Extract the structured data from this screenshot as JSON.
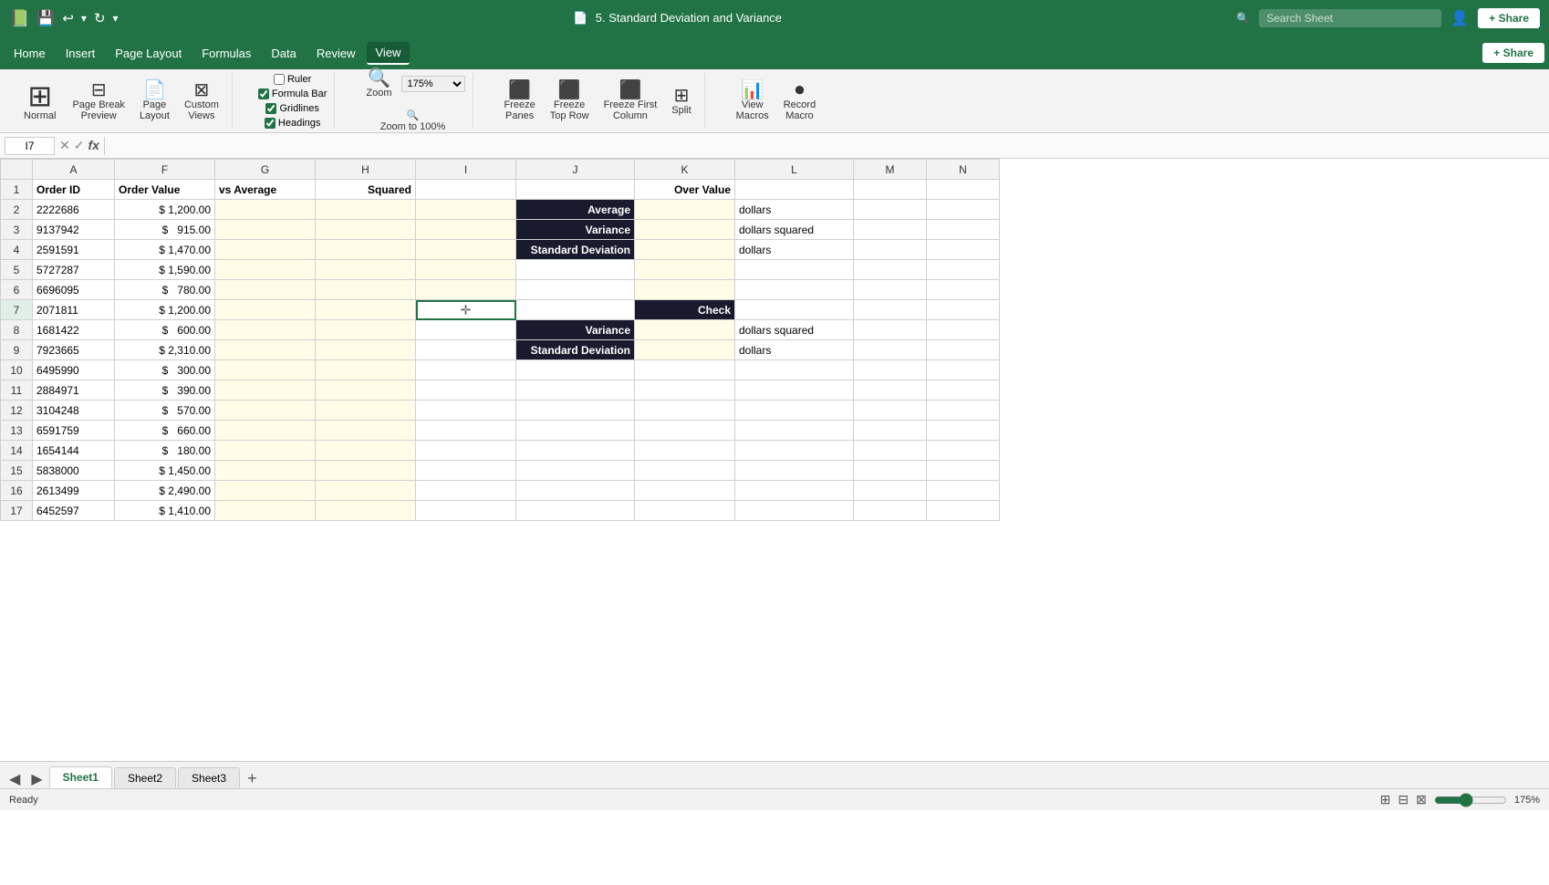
{
  "titleBar": {
    "fileIcon": "📄",
    "title": "5. Standard Deviation and Variance",
    "undoIcon": "↩",
    "redoIcon": "↻",
    "saveIcon": "💾",
    "moreIcon": "▾",
    "searchPlaceholder": "Search Sheet",
    "profileIcon": "👤",
    "shareLabel": "+ Share"
  },
  "menuBar": {
    "items": [
      "Home",
      "Insert",
      "Page Layout",
      "Formulas",
      "Data",
      "Review",
      "View"
    ]
  },
  "ribbon": {
    "view": {
      "normalLabel": "Normal",
      "pageBreakLabel": "Page Break\nPreview",
      "pageLayoutLabel": "Page\nLayout",
      "customViewsLabel": "Custom\nViews",
      "rulerLabel": "Ruler",
      "formulaBarLabel": "Formula Bar",
      "gridlinesLabel": "Gridlines",
      "headingsLabel": "Headings",
      "zoomLabel": "Zoom",
      "zoomValue": "175%",
      "zoom100Label": "Zoom to 100%",
      "freezePanesLabel": "Freeze\nPanes",
      "freezeTopRowLabel": "Freeze\nTop Row",
      "freezeFirstColLabel": "Freeze First\nColumn",
      "splitLabel": "Split",
      "viewMacrosLabel": "View\nMacros",
      "recordMacroLabel": "Record\nMacro"
    }
  },
  "formulaBar": {
    "cellRef": "I7",
    "cancelIcon": "✕",
    "confirmIcon": "✓",
    "functionIcon": "fx",
    "formula": ""
  },
  "spreadsheet": {
    "columns": [
      "",
      "A",
      "F",
      "G",
      "H",
      "I",
      "J",
      "K",
      "L",
      "M",
      "N"
    ],
    "rows": [
      {
        "row": "1",
        "A": "Order ID",
        "F": "Order Value",
        "G": "vs Average",
        "H": "Squared",
        "I": "",
        "J": "",
        "K": "Over Value",
        "L": "",
        "M": "",
        "N": ""
      },
      {
        "row": "2",
        "A": "2222686",
        "F": "$ 1,200.00",
        "G": "",
        "H": "",
        "I": "",
        "J": "Average",
        "K": "",
        "L": "dollars",
        "M": "",
        "N": ""
      },
      {
        "row": "3",
        "A": "9137942",
        "F": "$   915.00",
        "G": "",
        "H": "",
        "I": "",
        "J": "Variance",
        "K": "",
        "L": "dollars squared",
        "M": "",
        "N": ""
      },
      {
        "row": "4",
        "A": "2591591",
        "F": "$ 1,470.00",
        "G": "",
        "H": "",
        "I": "",
        "J": "Standard Deviation",
        "K": "",
        "L": "dollars",
        "M": "",
        "N": ""
      },
      {
        "row": "5",
        "A": "5727287",
        "F": "$ 1,590.00",
        "G": "",
        "H": "",
        "I": "",
        "J": "",
        "K": "",
        "L": "",
        "M": "",
        "N": ""
      },
      {
        "row": "6",
        "A": "6696095",
        "F": "$   780.00",
        "G": "",
        "H": "",
        "I": "",
        "J": "",
        "K": "",
        "L": "",
        "M": "",
        "N": ""
      },
      {
        "row": "7",
        "A": "2071811",
        "F": "$ 1,200.00",
        "G": "",
        "H": "",
        "I": "",
        "J": "",
        "K": "Check",
        "L": "",
        "M": "",
        "N": ""
      },
      {
        "row": "8",
        "A": "1681422",
        "F": "$   600.00",
        "G": "",
        "H": "",
        "I": "",
        "J": "Variance",
        "K": "",
        "L": "dollars squared",
        "M": "",
        "N": ""
      },
      {
        "row": "9",
        "A": "7923665",
        "F": "$ 2,310.00",
        "G": "",
        "H": "",
        "I": "",
        "J": "Standard Deviation",
        "K": "",
        "L": "dollars",
        "M": "",
        "N": ""
      },
      {
        "row": "10",
        "A": "6495990",
        "F": "$   300.00",
        "G": "",
        "H": "",
        "I": "",
        "J": "",
        "K": "",
        "L": "",
        "M": "",
        "N": ""
      },
      {
        "row": "11",
        "A": "2884971",
        "F": "$   390.00",
        "G": "",
        "H": "",
        "I": "",
        "J": "",
        "K": "",
        "L": "",
        "M": "",
        "N": ""
      },
      {
        "row": "12",
        "A": "3104248",
        "F": "$   570.00",
        "G": "",
        "H": "",
        "I": "",
        "J": "",
        "K": "",
        "L": "",
        "M": "",
        "N": ""
      },
      {
        "row": "13",
        "A": "6591759",
        "F": "$   660.00",
        "G": "",
        "H": "",
        "I": "",
        "J": "",
        "K": "",
        "L": "",
        "M": "",
        "N": ""
      },
      {
        "row": "14",
        "A": "1654144",
        "F": "$   180.00",
        "G": "",
        "H": "",
        "I": "",
        "J": "",
        "K": "",
        "L": "",
        "M": "",
        "N": ""
      },
      {
        "row": "15",
        "A": "5838000",
        "F": "$ 1,450.00",
        "G": "",
        "H": "",
        "I": "",
        "J": "",
        "K": "",
        "L": "",
        "M": "",
        "N": ""
      },
      {
        "row": "16",
        "A": "2613499",
        "F": "$ 2,490.00",
        "G": "",
        "H": "",
        "I": "",
        "J": "",
        "K": "",
        "L": "",
        "M": "",
        "N": ""
      },
      {
        "row": "17",
        "A": "6452597",
        "F": "$ 1,410.00",
        "G": "",
        "H": "",
        "I": "",
        "J": "",
        "K": "",
        "L": "",
        "M": "",
        "N": ""
      }
    ]
  },
  "sheetTabs": {
    "tabs": [
      "Sheet1",
      "Sheet2",
      "Sheet3"
    ],
    "activeTab": "Sheet1"
  },
  "statusBar": {
    "status": "Ready",
    "normalViewLabel": "⊞",
    "pageBreakViewLabel": "⊟",
    "pageLayoutViewLabel": "⊠",
    "zoomLevel": "175%"
  }
}
